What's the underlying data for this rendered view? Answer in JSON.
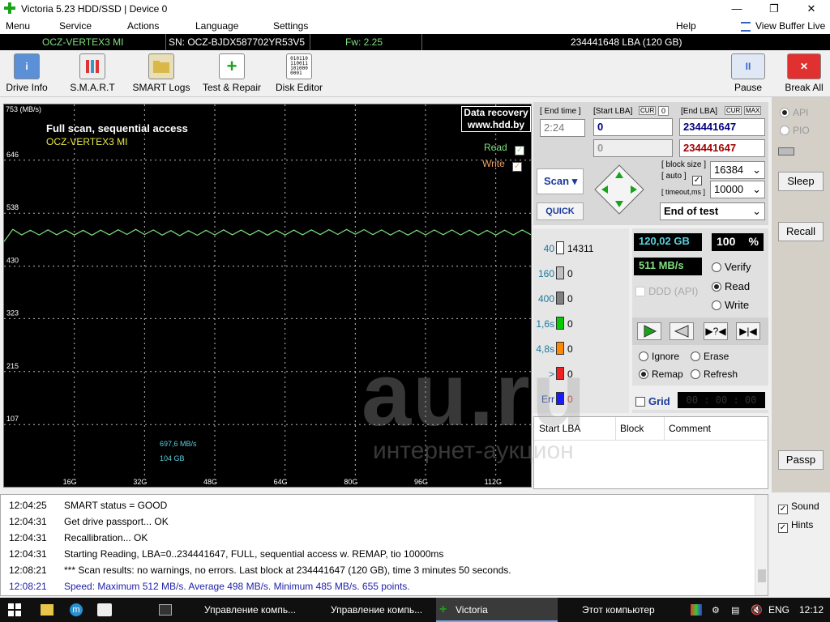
{
  "window": {
    "title": "Victoria 5.23 HDD/SSD | Device 0"
  },
  "menu": {
    "items": [
      "Menu",
      "Service",
      "Actions",
      "Language",
      "Settings"
    ],
    "help": "Help",
    "view_buffer": "View Buffer Live"
  },
  "device": {
    "model": "OCZ-VERTEX3 MI",
    "serial": "SN: OCZ-BJDX587702YR53V5",
    "firmware": "Fw: 2.25",
    "capacity": "234441648 LBA (120 GB)"
  },
  "toolbar": {
    "drive_info": "Drive Info",
    "smart": "S.M.A.R.T",
    "smart_logs": "SMART Logs",
    "test_repair": "Test & Repair",
    "disk_editor": "Disk Editor",
    "pause": "Pause",
    "break_all": "Break All"
  },
  "graph": {
    "title": "Full scan, sequential access",
    "model": "OCZ-VERTEX3 MI",
    "y_unit": "753 (MB/s)",
    "y_ticks": [
      "646",
      "538",
      "430",
      "323",
      "215",
      "107"
    ],
    "x_ticks": [
      "16G",
      "32G",
      "48G",
      "64G",
      "80G",
      "96G",
      "112G"
    ],
    "read_label": "Read",
    "write_label": "Write",
    "recovery_line1": "Data recovery",
    "recovery_line2": "www.hdd.by",
    "cursor_speed": "697,6 MB/s",
    "cursor_pos": "104 GB",
    "accent": "#7fe07f"
  },
  "chart_data": {
    "type": "line",
    "x_unit": "GB",
    "ylim": [
      0,
      753
    ],
    "xlim": [
      0,
      120
    ],
    "series": [
      {
        "name": "Read",
        "x": [
          0,
          2,
          5,
          10,
          20,
          30,
          40,
          50,
          60,
          70,
          80,
          90,
          100,
          110,
          120
        ],
        "values": [
          485,
          500,
          498,
          499,
          498,
          500,
          497,
          499,
          498,
          499,
          500,
          498,
          499,
          498,
          499
        ]
      }
    ]
  },
  "scan": {
    "end_time_label": "[ End time ]",
    "end_time": "2:24",
    "start_lba_label": "[Start LBA]",
    "cur_label": "CUR",
    "start_cur": "0",
    "end_lba_label": "[End LBA]",
    "max_label": "MAX",
    "start_lba": "0",
    "end_lba": "234441647",
    "start_lba2": "0",
    "end_lba2": "234441647",
    "scan_button": "Scan",
    "quick_button": "QUICK",
    "block_size_label": "[ block size ]",
    "auto_label": "[ auto ]",
    "block_size": "16384",
    "timeout_label": "[ timeout,ms ]",
    "timeout": "10000",
    "end_action": "End of test"
  },
  "stats": {
    "rows": [
      {
        "label": "40",
        "count": "14311",
        "color": "#ffffff"
      },
      {
        "label": "160",
        "count": "0",
        "color": "#c0c0c0"
      },
      {
        "label": "400",
        "count": "0",
        "color": "#808080"
      },
      {
        "label": "1,6s",
        "count": "0",
        "color": "#00cc00"
      },
      {
        "label": "4,8s",
        "count": "0",
        "color": "#ff8800"
      },
      {
        "label": ">",
        "count": "0",
        "color": "#ee2222"
      },
      {
        "label": "Err",
        "count": "0",
        "color": "#1a1aff"
      }
    ],
    "progress_bytes": "120,02 GB",
    "percent": "100",
    "percent_sign": "%",
    "speed": "511 MB/s",
    "ddd": "DDD (API)",
    "verify": "Verify",
    "read": "Read",
    "write": "Write",
    "ignore": "Ignore",
    "erase": "Erase",
    "remap": "Remap",
    "refresh": "Refresh",
    "grid": "Grid",
    "timer": "00 : 00 : 00"
  },
  "table": {
    "col1": "Start LBA",
    "col2": "Block",
    "col3": "Comment"
  },
  "side": {
    "api": "API",
    "pio": "PIO",
    "sleep": "Sleep",
    "recall": "Recall",
    "passp": "Passp",
    "sound": "Sound",
    "hints": "Hints"
  },
  "log": [
    {
      "time": "12:04:25",
      "text": "SMART status = GOOD",
      "color": "#000000"
    },
    {
      "time": "12:04:31",
      "text": "Get drive passport... OK",
      "color": "#000000"
    },
    {
      "time": "12:04:31",
      "text": "Recallibration... OK",
      "color": "#000000"
    },
    {
      "time": "12:04:31",
      "text": "Starting Reading, LBA=0..234441647, FULL, sequential access w. REMAP, tio 10000ms",
      "color": "#000000"
    },
    {
      "time": "12:08:21",
      "text": "*** Scan results: no warnings, no errors. Last block at 234441647 (120 GB), time 3 minutes 50 seconds.",
      "color": "#000000"
    },
    {
      "time": "12:08:21",
      "text": "Speed: Maximum 512 MB/s. Average 498 MB/s. Minimum 485 MB/s. 655 points.",
      "color": "#2222aa"
    }
  ],
  "taskbar": {
    "tasks": [
      "Управление компь...",
      "Управление компь...",
      "Victoria",
      "Этот компьютер"
    ],
    "lang": "ENG",
    "clock": "12:12"
  },
  "watermark": {
    "line1": "au.ru",
    "line2": "интернет-аукцион"
  }
}
